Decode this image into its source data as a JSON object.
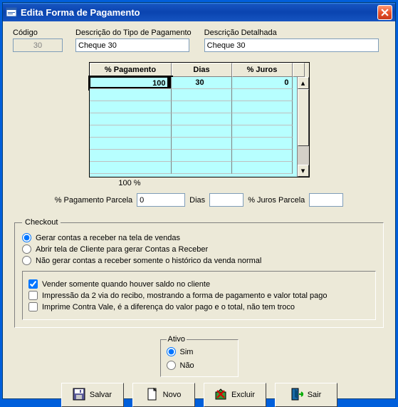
{
  "window": {
    "title": "Edita Forma de Pagamento"
  },
  "fields": {
    "codigo_label": "Código",
    "codigo_value": "30",
    "tipo_label": "Descrição do Tipo de Pagamento",
    "tipo_value": "Cheque 30",
    "detalhada_label": "Descrição Detalhada",
    "detalhada_value": "Cheque 30"
  },
  "grid": {
    "headers": {
      "pag": "% Pagamento",
      "dias": "Dias",
      "juros": "% Juros"
    },
    "rows": [
      {
        "pag": "100",
        "dias": "30",
        "juros": "0"
      }
    ],
    "footer": "100 %"
  },
  "parcela": {
    "pag_label": "% Pagamento Parcela",
    "pag_value": "0",
    "dias_label": "Dias",
    "dias_value": "",
    "juros_label": "% Juros Parcela",
    "juros_value": ""
  },
  "checkout": {
    "legend": "Checkout",
    "r1": "Gerar contas a receber na tela de vendas",
    "r2": "Abrir tela de Cliente para gerar Contas a Receber",
    "r3": "Não gerar contas a receber somente o histórico da venda normal",
    "c1": "Vender somente quando houver saldo no cliente",
    "c2": "Impressão da 2 via do recibo, mostrando a forma de pagamento e valor total pago",
    "c3": "Imprime Contra Vale, é a diferença do valor pago e o total, não tem troco"
  },
  "ativo": {
    "legend": "Ativo",
    "sim": "Sim",
    "nao": "Não"
  },
  "buttons": {
    "salvar": "Salvar",
    "novo": "Novo",
    "excluir": "Excluir",
    "sair": "Sair"
  }
}
